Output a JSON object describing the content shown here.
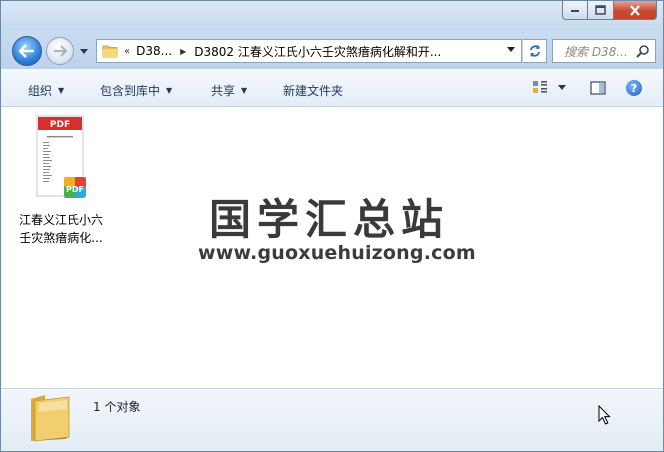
{
  "window": {
    "buttons": {
      "minimize": "minimize",
      "maximize": "maximize",
      "close": "close"
    }
  },
  "nav": {
    "address": {
      "overflow": "«",
      "crumbs": [
        "D38...",
        "D3802 江春义江氏小六壬灾煞瘖病化解和开..."
      ]
    },
    "search": {
      "placeholder": "搜索 D38..."
    }
  },
  "toolbar": {
    "organize": "组织",
    "include_in_library": "包含到库中",
    "share": "共享",
    "new_folder": "新建文件夹"
  },
  "files": [
    {
      "name_line1": "江春义江氏小六",
      "name_line2": "壬灾煞瘖病化...",
      "type": "pdf",
      "badge": "PDF"
    }
  ],
  "watermark": {
    "title": "国学汇总站",
    "url": "www.guoxuehuizong.com"
  },
  "details": {
    "count": "1 个对象"
  },
  "colors": {
    "accent": "#1e395b",
    "close": "#c74a33",
    "pdf_red": "#d8302c"
  }
}
